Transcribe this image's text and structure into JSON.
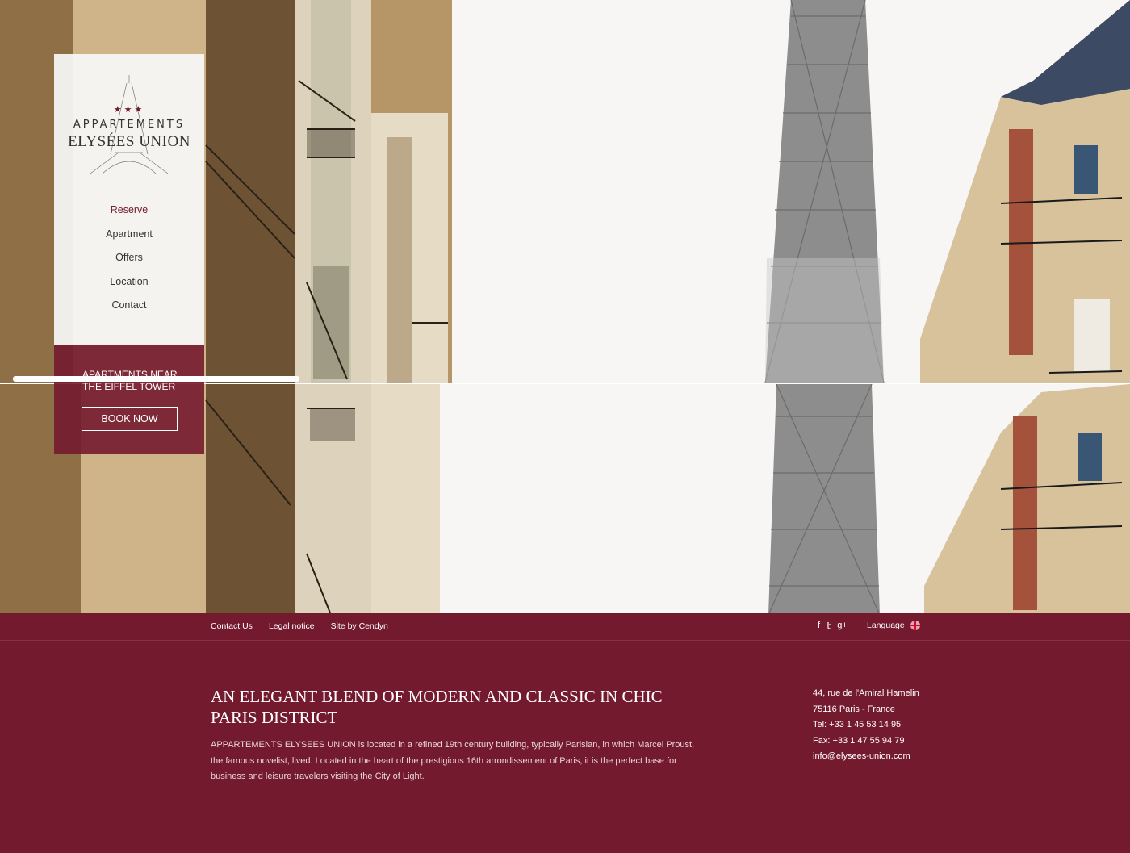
{
  "logo": {
    "stars": "★★★",
    "line1": "APPARTEMENTS",
    "line2": "ELYSÉES UNION"
  },
  "nav": {
    "items": [
      {
        "label": "Reserve",
        "active": true
      },
      {
        "label": "Apartment"
      },
      {
        "label": "Offers"
      },
      {
        "label": "Location"
      },
      {
        "label": "Contact"
      }
    ]
  },
  "promo": {
    "tagline": "APARTMENTS NEAR THE EIFFEL TOWER",
    "button": "BOOK NOW"
  },
  "footer_links": [
    "Contact Us",
    "Legal notice",
    "Site by Cendyn"
  ],
  "social": {
    "icons": [
      "facebook-icon",
      "twitter-icon",
      "google-plus-icon"
    ],
    "glyphs": [
      "f",
      "𝕥",
      "g+"
    ]
  },
  "language": {
    "label": "Language"
  },
  "about": {
    "heading": "AN ELEGANT BLEND OF MODERN AND CLASSIC IN CHIC PARIS DISTRICT",
    "body": "APPARTEMENTS ELYSEES UNION is located in a refined 19th century building, typically Parisian, in which Marcel Proust, the famous novelist, lived. Located in the heart of the prestigious 16th arrondissement of Paris, it is the perfect base for business and leisure travelers visiting the City of Light."
  },
  "contact": {
    "address1": "44, rue de l'Amiral Hamelin",
    "address2": "75116 Paris - France",
    "tel": "Tel: +33 1 45 53 14 95",
    "fax": "Fax: +33 1 47 55 94 79",
    "email": "info@elysees-union.com"
  },
  "colors": {
    "brand": "#741a2e",
    "tower": "#8a8a8a",
    "stone": "#c9ae7e"
  }
}
